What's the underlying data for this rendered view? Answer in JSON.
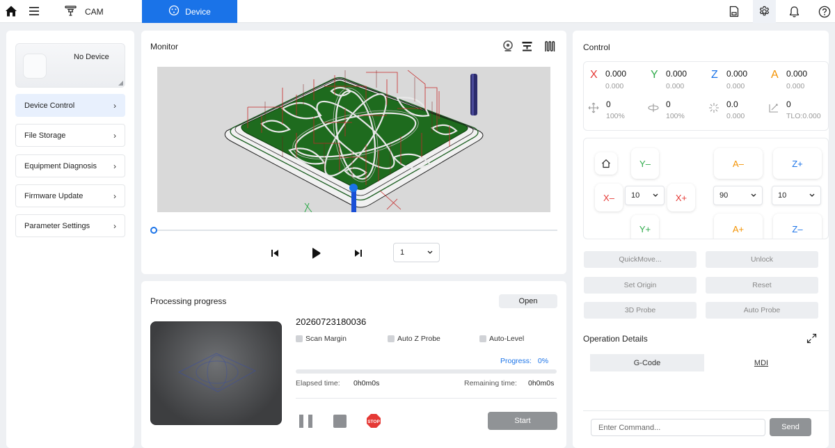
{
  "topbar": {
    "cam_label": "CAM",
    "device_tab_label": "Device",
    "icons": [
      "home-icon",
      "menu-icon",
      "cam-icon",
      "device-icon",
      "save-icon",
      "gear-icon",
      "bell-icon",
      "help-icon"
    ],
    "accent_color": "#1a73e8"
  },
  "sidebar": {
    "device_name": "No Device",
    "items": [
      {
        "label": "Device Control",
        "active": true
      },
      {
        "label": "File Storage",
        "active": false
      },
      {
        "label": "Equipment Diagnosis",
        "active": false
      },
      {
        "label": "Firmware Update",
        "active": false
      },
      {
        "label": "Parameter Settings",
        "active": false
      }
    ]
  },
  "monitor": {
    "title": "Monitor",
    "icons": [
      "webcam-icon",
      "machine-icon",
      "toolpath-icon"
    ],
    "playback_progress": 0,
    "speed_value": "1",
    "controls": [
      "skip-back-icon",
      "play-icon",
      "skip-forward-icon"
    ]
  },
  "progress": {
    "title": "Processing progress",
    "open_label": "Open",
    "job_name": "20260723180036",
    "options": [
      {
        "label": "Scan Margin",
        "checked": false
      },
      {
        "label": "Auto Z Probe",
        "checked": false
      },
      {
        "label": "Auto-Level",
        "checked": false
      }
    ],
    "progress_label": "Progress:",
    "progress_value": "0%",
    "progress_fraction": 0,
    "elapsed_label": "Elapsed time:",
    "elapsed_value": "0h0m0s",
    "remaining_label": "Remaining time:",
    "remaining_value": "0h0m0s",
    "start_label": "Start",
    "estop_label": "STOP"
  },
  "control": {
    "title": "Control",
    "axes": [
      {
        "letter": "X",
        "value": "0.000",
        "sub": "0.000",
        "color": "#e53935"
      },
      {
        "letter": "Y",
        "value": "0.000",
        "sub": "0.000",
        "color": "#2eaa4a"
      },
      {
        "letter": "Z",
        "value": "0.000",
        "sub": "0.000",
        "color": "#1a73e8"
      },
      {
        "letter": "A",
        "value": "0.000",
        "sub": "0.000",
        "color": "#f39200"
      }
    ],
    "stats": [
      {
        "icon": "feed-rate-icon",
        "value": "0",
        "sub": "100%"
      },
      {
        "icon": "spindle-icon",
        "value": "0",
        "sub": "100%"
      },
      {
        "icon": "laser-icon",
        "value": "0.0",
        "sub": "0.000"
      },
      {
        "icon": "tool-length-icon",
        "value": "0",
        "sub": "TLO:0.000"
      }
    ],
    "jog": {
      "y_minus": "Y–",
      "y_plus": "Y+",
      "x_minus": "X–",
      "x_plus": "X+",
      "a_minus": "A–",
      "a_plus": "A+",
      "z_plus": "Z+",
      "z_minus": "Z–",
      "step_xy": "10",
      "step_a": "90",
      "step_z": "10"
    },
    "buttons": {
      "quick_move": "QuickMove...",
      "unlock": "Unlock",
      "set_origin": "Set Origin",
      "reset": "Reset",
      "probe_3d": "3D Probe",
      "auto_probe": "Auto Probe"
    },
    "op_title": "Operation Details",
    "tab_gcode": "G-Code",
    "tab_mdi": "MDI",
    "cmd_placeholder": "Enter Command...",
    "send_label": "Send"
  }
}
